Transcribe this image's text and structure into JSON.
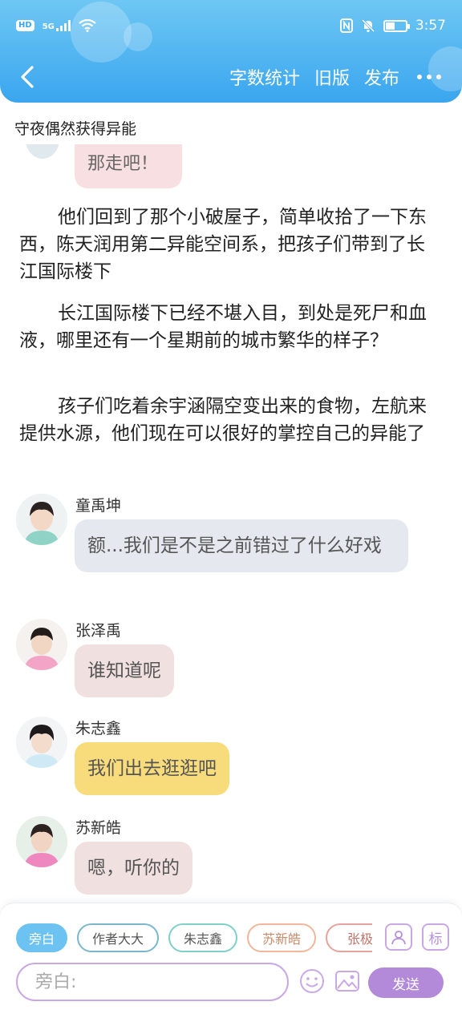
{
  "status_bar": {
    "hd": "HD",
    "network": "5G",
    "time": "3:57",
    "battery_level": 0.45
  },
  "toolbar": {
    "word_count": "字数统计",
    "old_version": "旧版",
    "publish": "发布"
  },
  "document": {
    "title": "守夜偶然获得异能"
  },
  "partial_message": {
    "text": "那走吧！"
  },
  "paragraphs": [
    "他们回到了那个小破屋子，简单收拾了一下东西，陈天润用第二异能空间系，把孩子们带到了长江国际楼下",
    "长江国际楼下已经不堪入目，到处是死尸和血液，哪里还有一个星期前的城市繁华的样子？",
    "孩子们吃着余宇涵隔空变出来的食物，左航来提供水源，他们现在可以很好的掌控自己的异能了"
  ],
  "messages": [
    {
      "name": "童禹坤",
      "text": "额...我们是不是之前错过了什么好戏",
      "bubble_color": "#e5e9ef",
      "shirt_color": "#8fd3c6"
    },
    {
      "name": "张泽禹",
      "text": "谁知道呢",
      "bubble_color": "#f1e0e0",
      "shirt_color": "#f3a5c8"
    },
    {
      "name": "朱志鑫",
      "text": "我们出去逛逛吧",
      "bubble_color": "#f8dc7c",
      "shirt_color": "#cfeaf4"
    },
    {
      "name": "苏新皓",
      "text": "嗯，听你的",
      "bubble_color": "#f1e0e0",
      "shirt_color": "#f088c0"
    }
  ],
  "input_panel": {
    "roles": [
      "旁白",
      "作者大大",
      "朱志鑫",
      "苏新皓",
      "张极"
    ],
    "active_role": "旁白",
    "tag_button": "标",
    "placeholder": "旁白:",
    "send_label": "发送"
  },
  "colors": {
    "header_top": "#6ec7f3",
    "header_bottom": "#3aa6ef",
    "accent_purple": "#b28ad9"
  }
}
